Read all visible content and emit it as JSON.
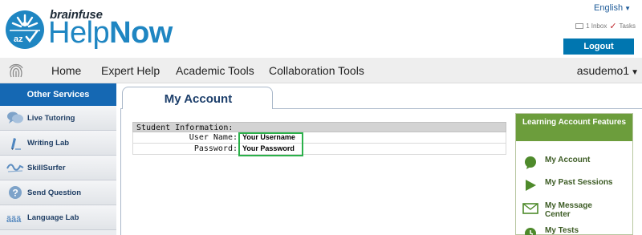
{
  "header": {
    "brand_small": "brainfuse",
    "brand_help": "Help",
    "brand_now": "Now",
    "language": "English",
    "inbox_text": "1 Inbox",
    "tasks_text": "Tasks",
    "logout_label": "Logout"
  },
  "nav": {
    "items": [
      "Home",
      "Expert Help",
      "Academic Tools",
      "Collaboration Tools"
    ],
    "user": "asudemo1"
  },
  "sidebar": {
    "title": "Other Services",
    "items": [
      {
        "label": "Live Tutoring",
        "icon": "chat-bubbles-icon"
      },
      {
        "label": "Writing Lab",
        "icon": "pen-icon"
      },
      {
        "label": "SkillSurfer",
        "icon": "wave-icon"
      },
      {
        "label": "Send Question",
        "icon": "question-icon"
      },
      {
        "label": "Language Lab",
        "icon": "letters-icon"
      }
    ]
  },
  "main": {
    "tab_label": "My Account",
    "section_title": "Student Information:",
    "username_label": "User Name:",
    "username_value": "Your Username",
    "password_label": "Password:",
    "password_value": "Your Password"
  },
  "features": {
    "title": "Learning Account Features",
    "items": [
      {
        "label": "My Account",
        "icon": "speech-bubble-icon"
      },
      {
        "label": "My Past Sessions",
        "icon": "play-icon"
      },
      {
        "label": "My Message Center",
        "icon": "envelope-icon"
      },
      {
        "label": "My Tests",
        "icon": "clock-icon"
      }
    ]
  },
  "colors": {
    "brand_blue": "#1f86c2",
    "nav_blue": "#1568b3",
    "logout_blue": "#0076b0",
    "feature_green": "#6c9d3c",
    "highlight_green": "#2bb14a"
  }
}
